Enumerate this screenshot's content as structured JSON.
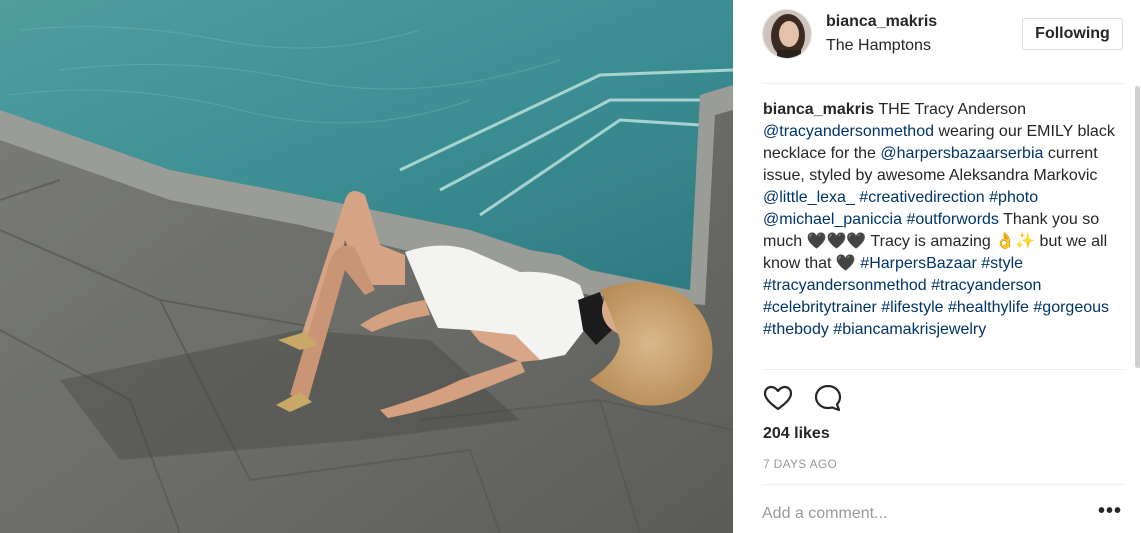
{
  "post": {
    "username": "bianca_makris",
    "location": "The Hamptons",
    "follow_label": "Following",
    "caption": {
      "user": "bianca_makris",
      "p1": " THE Tracy Anderson ",
      "m1": "@tracyandersonmethod",
      "p2": " wearing our EMILY black necklace for the ",
      "m2": "@harpersbazaarserbia",
      "p3": " current issue, styled by awesome Aleksandra Markovic ",
      "m3": "@little_lexa_",
      "s1": " ",
      "h1": "#creativedirection",
      "s2": " ",
      "h2": "#photo",
      "s3": " ",
      "m4": "@michael_paniccia",
      "s4": " ",
      "h3": "#outforwords",
      "p4": " Thank you so much 🖤🖤🖤 Tracy is amazing 👌✨ but we all know that 🖤 ",
      "h4": "#HarpersBazaar",
      "s5": " ",
      "h5": "#style",
      "s6": " ",
      "h6": "#tracyandersonmethod",
      "s7": " ",
      "h7": "#tracyanderson",
      "s8": " ",
      "h8": "#celebritytrainer",
      "s9": " ",
      "h9": "#lifestyle",
      "s10": " ",
      "h10": "#healthylife",
      "s11": " ",
      "h11": "#gorgeous",
      "s12": " ",
      "h12": "#thebody",
      "s13": " ",
      "h13": "#biancamakrisjewelry"
    },
    "likes": "204 likes",
    "time": "7 DAYS AGO",
    "comment_placeholder": "Add a comment...",
    "more_label": "•••"
  },
  "icons": {
    "like": "heart-icon",
    "comment": "comment-bubble-icon",
    "more": "more-options-icon"
  },
  "colors": {
    "text": "#262626",
    "link": "#003569",
    "muted": "#999999",
    "border": "#dbdbdb"
  }
}
